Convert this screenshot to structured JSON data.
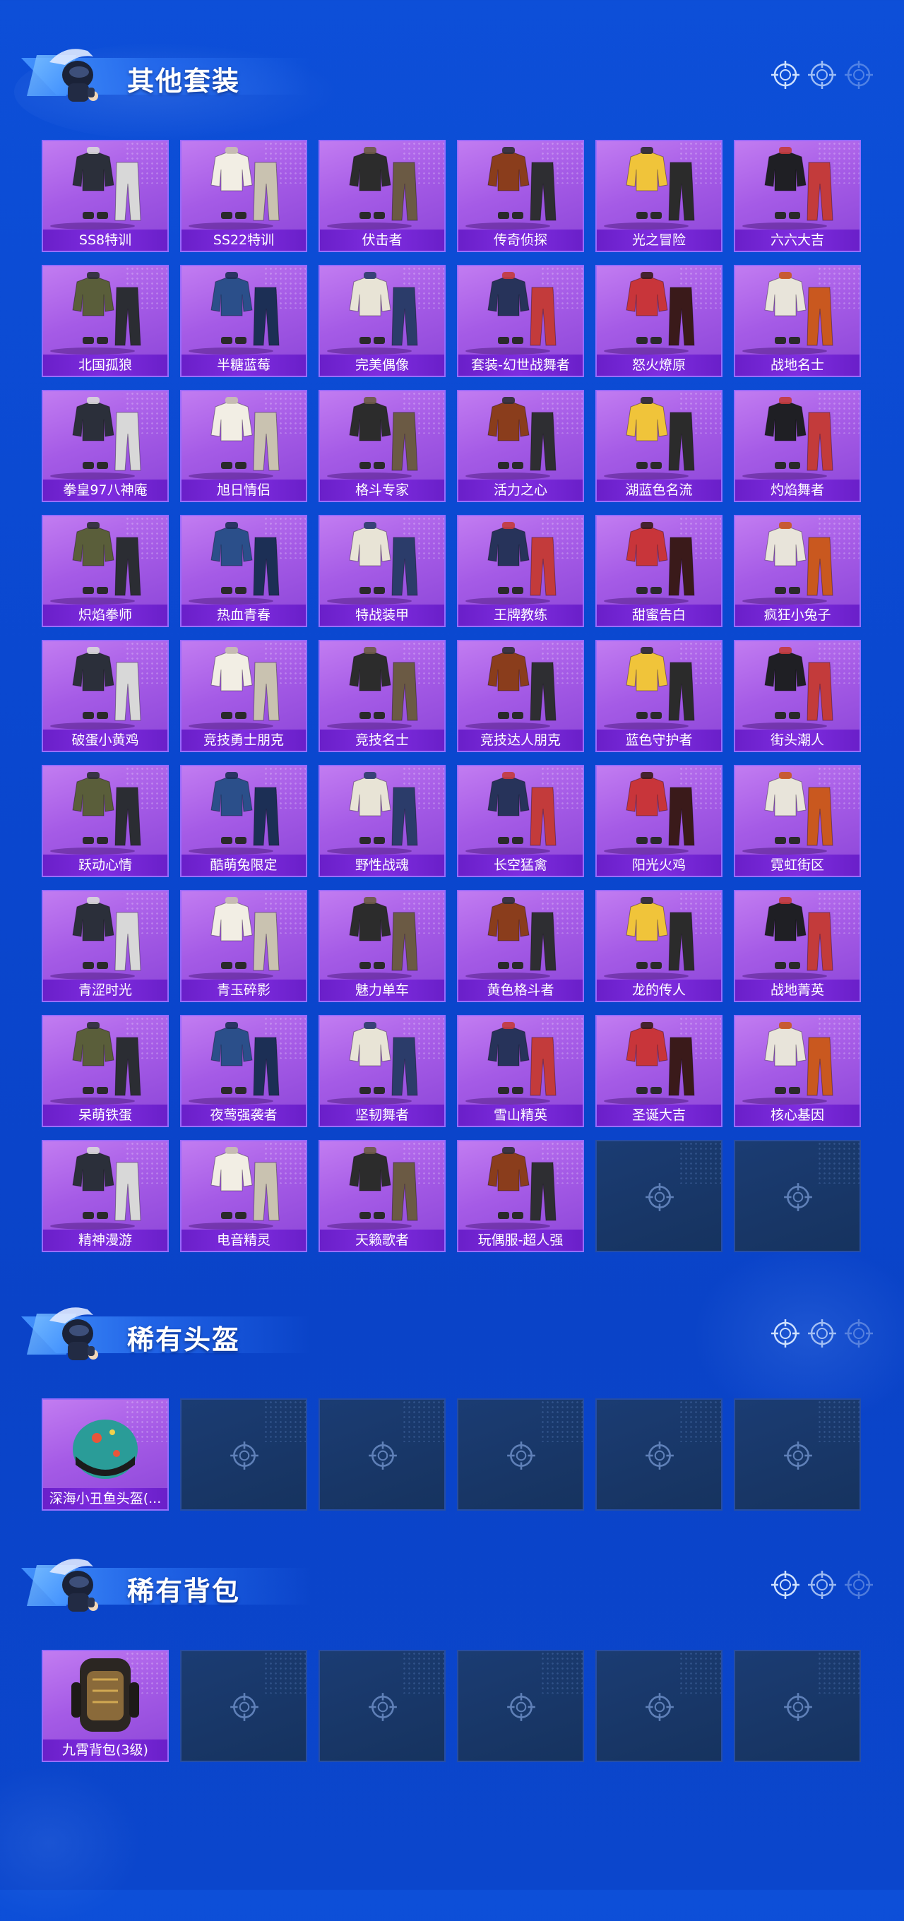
{
  "sections": [
    {
      "title": "其他套装",
      "items": [
        "SS8特训",
        "SS22特训",
        "伏击者",
        "传奇侦探",
        "光之冒险",
        "六六大吉",
        "北国孤狼",
        "半糖蓝莓",
        "完美偶像",
        "套装-幻世战舞者",
        "怒火燎原",
        "战地名士",
        "拳皇97八神庵",
        "旭日情侣",
        "格斗专家",
        "活力之心",
        "湖蓝色名流",
        "灼焰舞者",
        "炽焰拳师",
        "热血青春",
        "特战装甲",
        "王牌教练",
        "甜蜜告白",
        "疯狂小兔子",
        "破蛋小黄鸡",
        "竞技勇士朋克",
        "竞技名士",
        "竞技达人朋克",
        "蓝色守护者",
        "街头潮人",
        "跃动心情",
        "酷萌兔限定",
        "野性战魂",
        "长空猛禽",
        "阳光火鸡",
        "霓虹街区",
        "青涩时光",
        "青玉碎影",
        "魅力单车",
        "黄色格斗者",
        "龙的传人",
        "战地菁英",
        "呆萌铁蛋",
        "夜莺强袭者",
        "坚韧舞者",
        "雪山精英",
        "圣诞大吉",
        "核心基因",
        "精神漫游",
        "电音精灵",
        "天籁歌者",
        "玩偶服-超人强"
      ],
      "empty_slots": 2
    },
    {
      "title": "稀有头盔",
      "items": [
        "深海小丑鱼头盔(..."
      ],
      "empty_slots": 5
    },
    {
      "title": "稀有背包",
      "items": [
        "九霄背包(3级)"
      ],
      "empty_slots": 5
    }
  ],
  "icons": {
    "section_badge": "parachute-soldier-icon",
    "header_decor": "crosshair-icon",
    "empty_slot": "crosshair-icon",
    "card_art": "outfit-icon"
  },
  "colors": {
    "background": "#0b49d0",
    "card_purple": "#a55be6",
    "label_purple": "#7f2de0",
    "empty_slot": "#18365f"
  }
}
